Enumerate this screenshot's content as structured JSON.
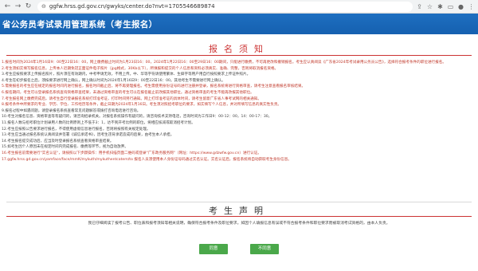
{
  "browser": {
    "url": "ggfw.hrss.gd.gov.cn/gwyks/center.do?nvt=1705546689874",
    "toolbar_icons": [
      "share-icon",
      "bookmark-icon",
      "extension-icon",
      "sidebar-icon",
      "profile-icon",
      "menu-icon"
    ]
  },
  "banner": {
    "title": "省公务员考试录用管理系统（考生报名）"
  },
  "notice": {
    "title": "报名须知",
    "lines": [
      {
        "text": "1.报名时间为2024年1月16日9：00至22日16：00，网上缴费截止时间为1月23日16：00，2024年1月22日16：00至29日16：00期间，只能进行缴费，不可再更改和撤销报名。考生应认真阅读《广东省2024年考试录用公务员公告》，选择符合报考条件的职位进行报名。",
        "color": "red"
      },
      {
        "text": "2.考生须如实填写报名信息，上传本人近期免冠正面证件电子照片（jpg格式，30Kb以下），所填报和提交的个人信息和资料必须真实、准确、完整，否则将取消报名资格。",
        "color": "red"
      },
      {
        "text": "3.考生应按照要求上传报名照片，照片须在有效期内，中考申请无效，不用上传。中、华等字符请使用繁体、生僻字等用户用自行按照要求上传证件照片。",
        "color": "dark"
      },
      {
        "text": "4.考生在初步报名之后，须按要求进行网上确认，网上确认时间为2024年1月16日9：00至22日16：00。其他考生不需要进行网上确认。",
        "color": "dark"
      },
      {
        "text": "5.需要报名的考生应在规定的报名时间内进行报名，报名时间截止后，将不再受理报名。考生需使用身份证号码进行注册并登录，报名系统将进行资格审查，请考生注意查看报名审核结果。",
        "color": "red"
      },
      {
        "text": "6.报名期间，考生可以登录报名系统查询资格审查结果，未通过资格审查的考生可以在报名截止前改报其他职位。通过资格审查的考生不能再改报其他职位。",
        "color": "red"
      },
      {
        "text": "7.考生报名网上缴费完成后，请考生自行登录报名系统打印准考证，打印时间另行通知。网上打印准考证的具体时间，请考生留意广东省人事考试网的相关通知。",
        "color": "red"
      },
      {
        "text": "8.报考条件中所要求的专业、学历、学位、工作经历等条件，截止日期为2024年1月16日。考生须对照招考职位的要求，如实填写个人信息，并对所填写信息的真实性负责。",
        "color": "red"
      },
      {
        "text": "9.报名过程中如遇问题，请登录报名系统查看常见问题解答或拨打咨询电话进行咨询。",
        "color": "dark"
      },
      {
        "text": "10.考生对报名信息、资格审查等有疑问的，请咨询招录机关。对报名系统操作有疑问的，请咨询技术支持电话，咨询时间为工作日9：00-12：00，14：00-17：30。",
        "color": "dark"
      },
      {
        "text": "11.报名人数与招考职位计划录用人数的比例原则上不低于3：1，达不到开考比例的职位，将相应核减或取消招考计划。",
        "color": "dark"
      },
      {
        "text": "12.考生应按照公告要求进行报名，不得使用虚假信息进行报名，否则将按照有关规定处理。",
        "color": "dark"
      },
      {
        "text": "13.考生应当通过报名系统认真阅读并签署《诚信承诺书》，因考生违背承诺造成的后果，由考生本人承担。",
        "color": "dark"
      },
      {
        "text": "14.考生报名提交成功后，应当及时登录报名系统查看资格审查结果。",
        "color": "dark"
      },
      {
        "text": "15.如考生因个人原因未在规定时间内完成报名、缴费等环节，视为自动放弃。",
        "color": "dark"
      },
      {
        "text": "16.考生报名前需要进行\"实名认证\"，请按照以下步骤操作：用手机扫描页面二维码或登录\"广东政务服务网\"（网址：https://www.gdzwfw.gov.cn）进行认证。",
        "color": "red"
      },
      {
        "text": "17.ggfw.hrss.gd.gov.cn/yamface/face/mmK/mykuth/mykuthentcatem/to 报名人员须使用本人身份证号码通过实名认证。实名认证后，报名系统将自动获取考生身份信息。",
        "color": "red"
      }
    ]
  },
  "declaration": {
    "title": "考生声明",
    "text": "我已仔细阅读了报考公告、职位表和报考须知等相关说明，确保符合报考条件及职位要求。如因个人填报信息有误或不符合报考条件和职位要求而被取消考试资格的，由本人负责。"
  },
  "buttons": {
    "agree_label": "同意",
    "disagree_label": "不同意"
  }
}
